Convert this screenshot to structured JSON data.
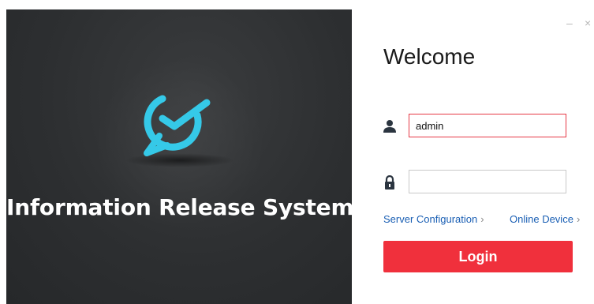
{
  "branding": {
    "app_name": "Information Release System"
  },
  "window": {
    "minimize_symbol": "–",
    "close_symbol": "×"
  },
  "login": {
    "welcome": "Welcome",
    "username_value": "admin",
    "password_value": "",
    "server_config_label": "Server Configuration",
    "online_device_label": "Online Device",
    "link_chevron": "›",
    "login_label": "Login"
  },
  "colors": {
    "accent": "#f0303c",
    "link": "#1a5fb4",
    "logo": "#35c9e8",
    "left_bg": "#2d2f31"
  },
  "icons": {
    "logo": "chat-bubble-check-icon",
    "username": "user-icon",
    "password": "lock-icon"
  }
}
